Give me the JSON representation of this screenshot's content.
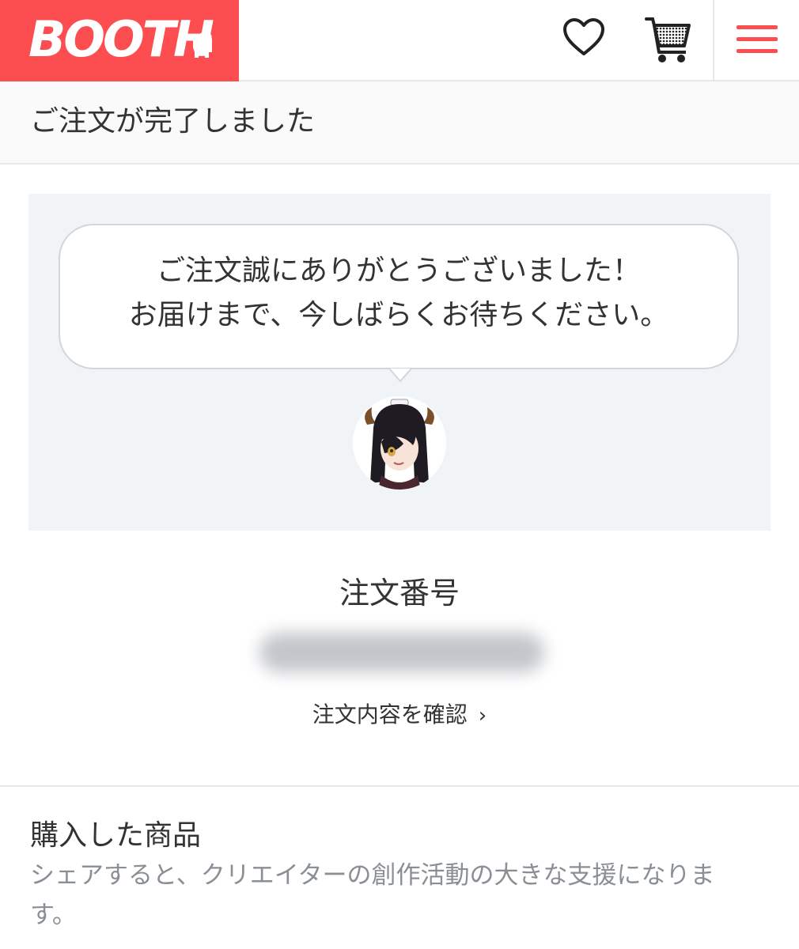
{
  "header": {
    "logo_text": "BOOTH",
    "brand_color": "#fc4d50",
    "icons": [
      "heart-icon",
      "cart-icon",
      "hamburger-menu-icon"
    ]
  },
  "page": {
    "title": "ご注文が完了しました"
  },
  "thanks": {
    "line1": "ご注文誠にありがとうございました！",
    "line2": "お届けまで、今しばらくお待ちください。",
    "avatar": "character-avatar"
  },
  "order": {
    "label": "注文番号",
    "details_link": "注文内容を確認"
  },
  "purchased": {
    "title": "購入した商品",
    "description": "シェアすると、クリエイターの創作活動の大きな支援になります。"
  }
}
